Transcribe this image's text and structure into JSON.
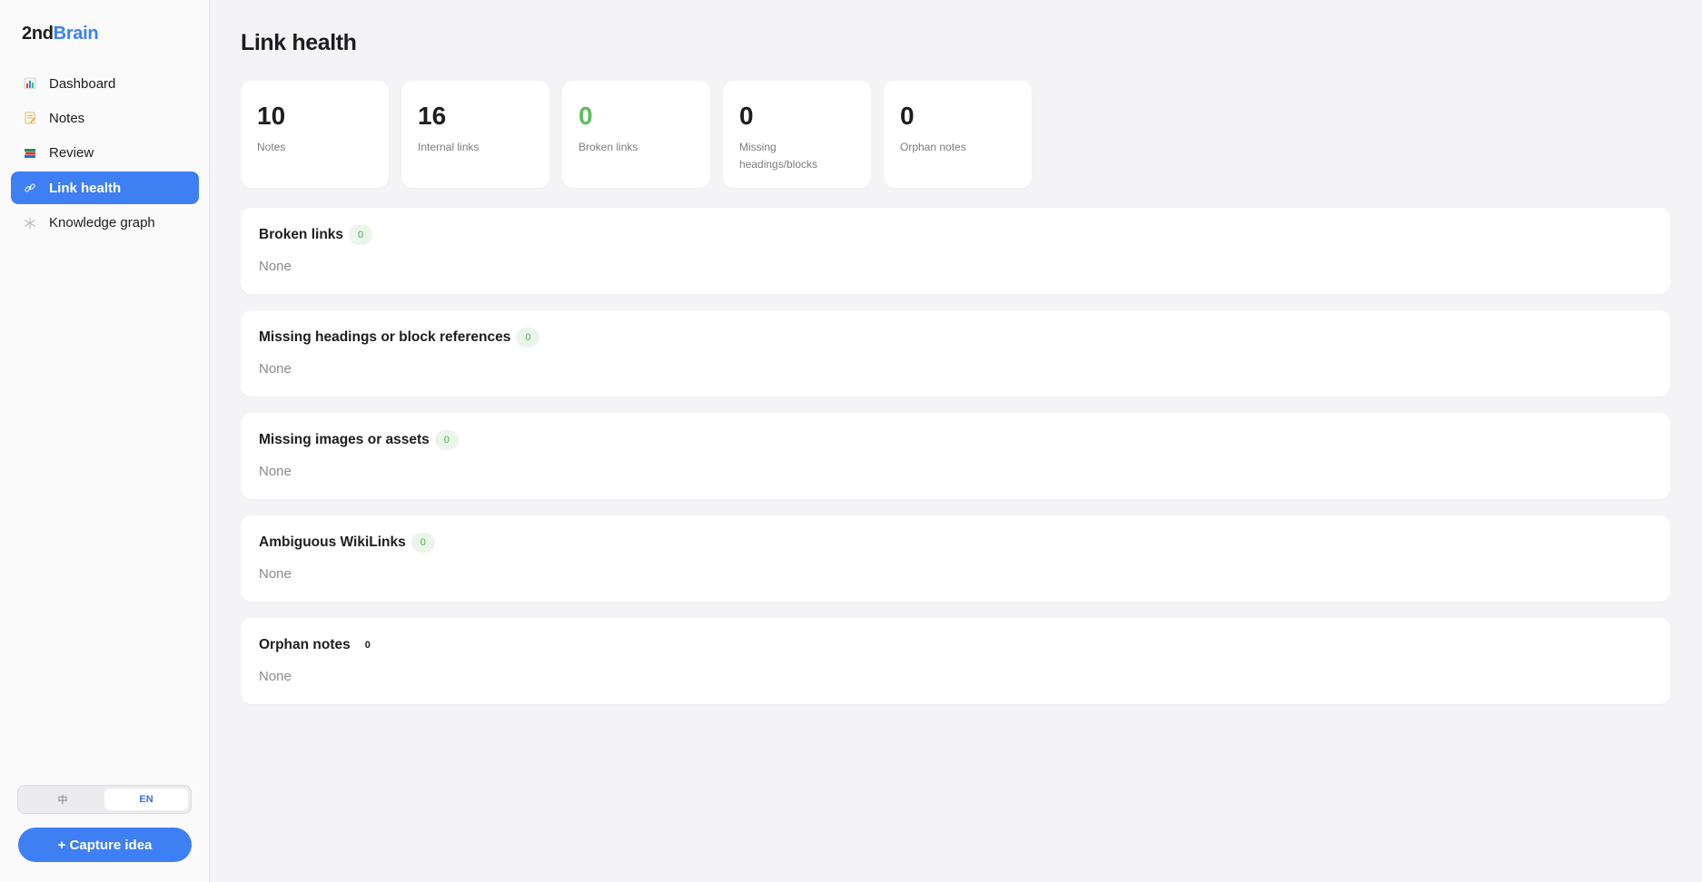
{
  "sidebar": {
    "logo_part1": "2nd",
    "logo_part2": "Brain",
    "items": [
      {
        "label": "Dashboard",
        "icon": "bar-chart-icon"
      },
      {
        "label": "Notes",
        "icon": "memo-icon"
      },
      {
        "label": "Review",
        "icon": "books-icon"
      },
      {
        "label": "Link health",
        "icon": "link-icon",
        "active": true
      },
      {
        "label": "Knowledge graph",
        "icon": "snowflake-icon"
      }
    ],
    "lang": {
      "zh": "中",
      "en": "EN",
      "selected": "EN"
    },
    "capture_label": "+ Capture idea"
  },
  "main": {
    "title": "Link health",
    "stats": [
      {
        "value": "10",
        "label": "Notes"
      },
      {
        "value": "16",
        "label": "Internal links"
      },
      {
        "value": "0",
        "label": "Broken links"
      },
      {
        "value": "0",
        "label": "Missing headings/blocks"
      },
      {
        "value": "0",
        "label": "Orphan notes"
      }
    ],
    "sections": [
      {
        "title": "Broken links",
        "count": "0",
        "body": "None"
      },
      {
        "title": "Missing headings or block references",
        "count": "0",
        "body": "None"
      },
      {
        "title": "Missing images or assets",
        "count": "0",
        "body": "None"
      },
      {
        "title": "Ambiguous WikiLinks",
        "count": "0",
        "body": "None"
      },
      {
        "title": "Orphan notes",
        "count": "0",
        "body": "None"
      }
    ]
  },
  "colors": {
    "accent": "#3f7ff4",
    "success": "#5cbf5c",
    "badge_bg": "#eaf6ea"
  }
}
